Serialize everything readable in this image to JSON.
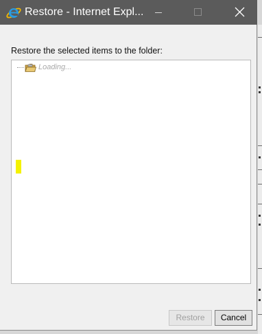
{
  "window": {
    "title": "Restore - Internet Expl...",
    "title_bar_color": "#5b5b5b",
    "controls": {
      "minimize_icon": "minimize-icon",
      "maximize_icon": "maximize-icon",
      "close_icon": "close-icon"
    },
    "app_icon": "internet-explorer-icon"
  },
  "dialog": {
    "prompt": "Restore the selected items to the folder:",
    "tree": {
      "root_node": {
        "icon": "folder-icon",
        "label": "Loading..."
      }
    },
    "highlight_color": "#f4f200"
  },
  "buttons": {
    "restore_label": "Restore",
    "cancel_label": "Cancel"
  }
}
